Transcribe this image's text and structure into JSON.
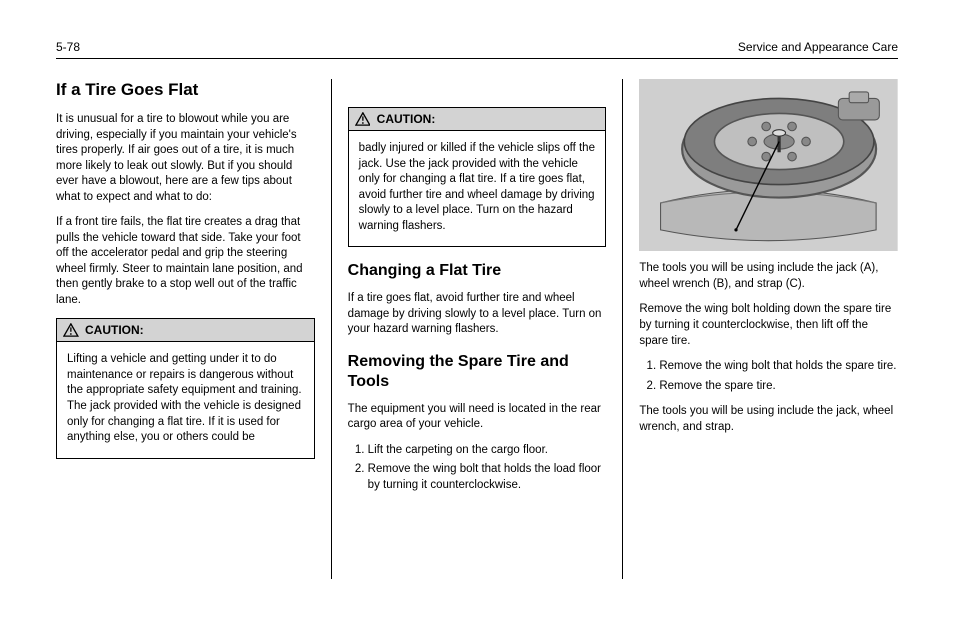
{
  "header": {
    "left": "5-78",
    "right": "Service and Appearance Care"
  },
  "col1": {
    "h2": "If a Tire Goes Flat",
    "p1": "It is unusual for a tire to blowout while you are driving, especially if you maintain your vehicle's tires properly. If air goes out of a tire, it is much more likely to leak out slowly. But if you should ever have a blowout, here are a few tips about what to expect and what to do:",
    "p2": "If a front tire fails, the flat tire creates a drag that pulls the vehicle toward that side. Take your foot off the accelerator pedal and grip the steering wheel firmly. Steer to maintain lane position, and then gently brake to a stop well out of the traffic lane.",
    "caution": {
      "label": "CAUTION:",
      "body": "Lifting a vehicle and getting under it to do maintenance or repairs is dangerous without the appropriate safety equipment and training. The jack provided with the vehicle is designed only for changing a flat tire. If it is used for anything else, you or others could be"
    }
  },
  "col2": {
    "caution": {
      "label": "CAUTION:",
      "body": "badly injured or killed if the vehicle slips off the jack. Use the jack provided with the vehicle only for changing a flat tire.\n\nIf a tire goes flat, avoid further tire and wheel damage by driving slowly to a level place. Turn on the hazard warning flashers."
    },
    "h3": "Changing a Flat Tire",
    "p1": "If a tire goes flat, avoid further tire and wheel damage by driving slowly to a level place. Turn on your hazard warning flashers.",
    "h3b": "Removing the Spare Tire and Tools",
    "p2": "The equipment you will need is located in the rear cargo area of your vehicle.",
    "ol": [
      "Lift the carpeting on the cargo floor.",
      "Remove the wing bolt that holds the load floor by turning it counterclockwise."
    ]
  },
  "col3": {
    "p1": "The tools you will be using include the jack (A), wheel wrench (B), and strap (C).",
    "p2": "Remove the wing bolt holding down the spare tire by turning it counterclockwise, then lift off the spare tire.",
    "ol": [
      "Remove the wing bolt that holds the spare tire.",
      "Remove the spare tire."
    ],
    "p3": "The tools you will be using include the jack, wheel wrench, and strap."
  },
  "icons": {
    "warning": "warning-triangle-icon"
  }
}
